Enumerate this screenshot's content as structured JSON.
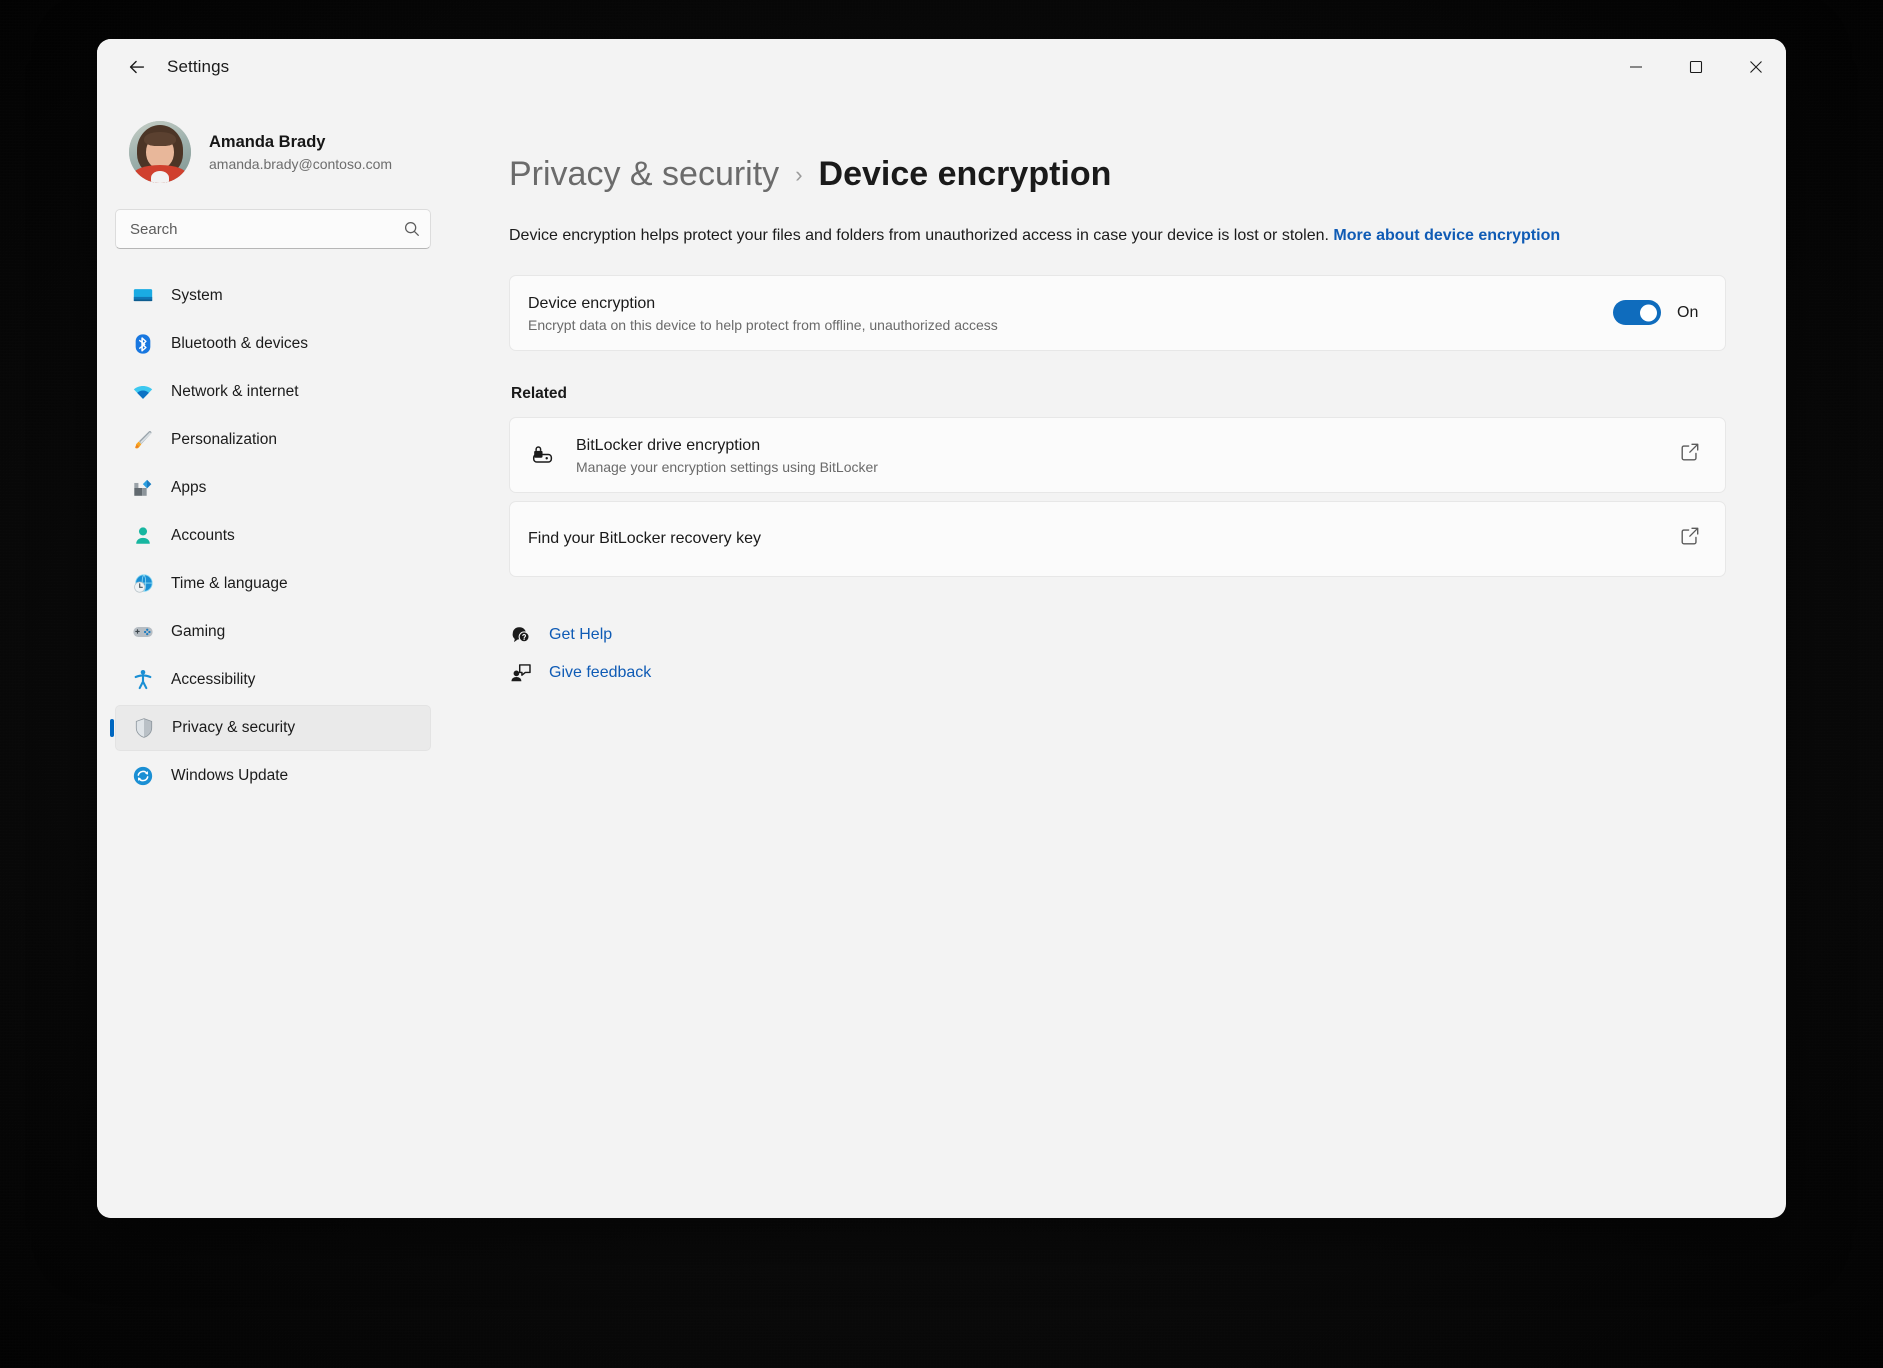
{
  "window": {
    "title": "Settings",
    "back_icon": "arrow-left-icon",
    "controls": {
      "minimize": "minimize-icon",
      "maximize": "maximize-icon",
      "close": "close-icon"
    }
  },
  "sidebar": {
    "profile": {
      "name": "Amanda Brady",
      "email": "amanda.brady@contoso.com",
      "avatar": "user-avatar"
    },
    "search": {
      "value": "",
      "placeholder": "Search",
      "icon": "search-icon"
    },
    "items": [
      {
        "label": "System",
        "icon": "monitor-icon",
        "selected": false
      },
      {
        "label": "Bluetooth & devices",
        "icon": "bluetooth-icon",
        "selected": false
      },
      {
        "label": "Network & internet",
        "icon": "wifi-icon",
        "selected": false
      },
      {
        "label": "Personalization",
        "icon": "paintbrush-icon",
        "selected": false
      },
      {
        "label": "Apps",
        "icon": "apps-grid-icon",
        "selected": false
      },
      {
        "label": "Accounts",
        "icon": "person-icon",
        "selected": false
      },
      {
        "label": "Time & language",
        "icon": "clock-globe-icon",
        "selected": false
      },
      {
        "label": "Gaming",
        "icon": "gamepad-icon",
        "selected": false
      },
      {
        "label": "Accessibility",
        "icon": "accessibility-person-icon",
        "selected": false
      },
      {
        "label": "Privacy & security",
        "icon": "shield-icon",
        "selected": true
      },
      {
        "label": "Windows Update",
        "icon": "refresh-circle-icon",
        "selected": false
      }
    ]
  },
  "main": {
    "breadcrumb": {
      "parent": "Privacy & security",
      "separator": "›",
      "current": "Device encryption"
    },
    "description": {
      "text": "Device encryption helps protect your files and folders from unauthorized access in case your device is lost or stolen. ",
      "link_text": "More about device encryption"
    },
    "encryption_card": {
      "title": "Device encryption",
      "subtitle": "Encrypt data on this device to help protect from offline, unauthorized access",
      "toggle_state": "On",
      "toggle_on": true
    },
    "related_heading": "Related",
    "related_items": [
      {
        "title": "BitLocker drive encryption",
        "subtitle": "Manage your encryption settings using BitLocker",
        "icon": "bitlocker-drive-icon",
        "action_icon": "external-link-icon"
      },
      {
        "title": "Find your BitLocker recovery key",
        "subtitle": "",
        "icon": "",
        "action_icon": "external-link-icon"
      }
    ],
    "footer_links": [
      {
        "label": "Get Help",
        "icon": "help-question-icon"
      },
      {
        "label": "Give feedback",
        "icon": "feedback-person-icon"
      }
    ]
  },
  "colors": {
    "accent": "#0f6cbd",
    "link": "#0f5bb5",
    "selection_bar": "#0067c0",
    "window_bg": "#f3f3f3",
    "card_bg": "#fbfbfb"
  }
}
